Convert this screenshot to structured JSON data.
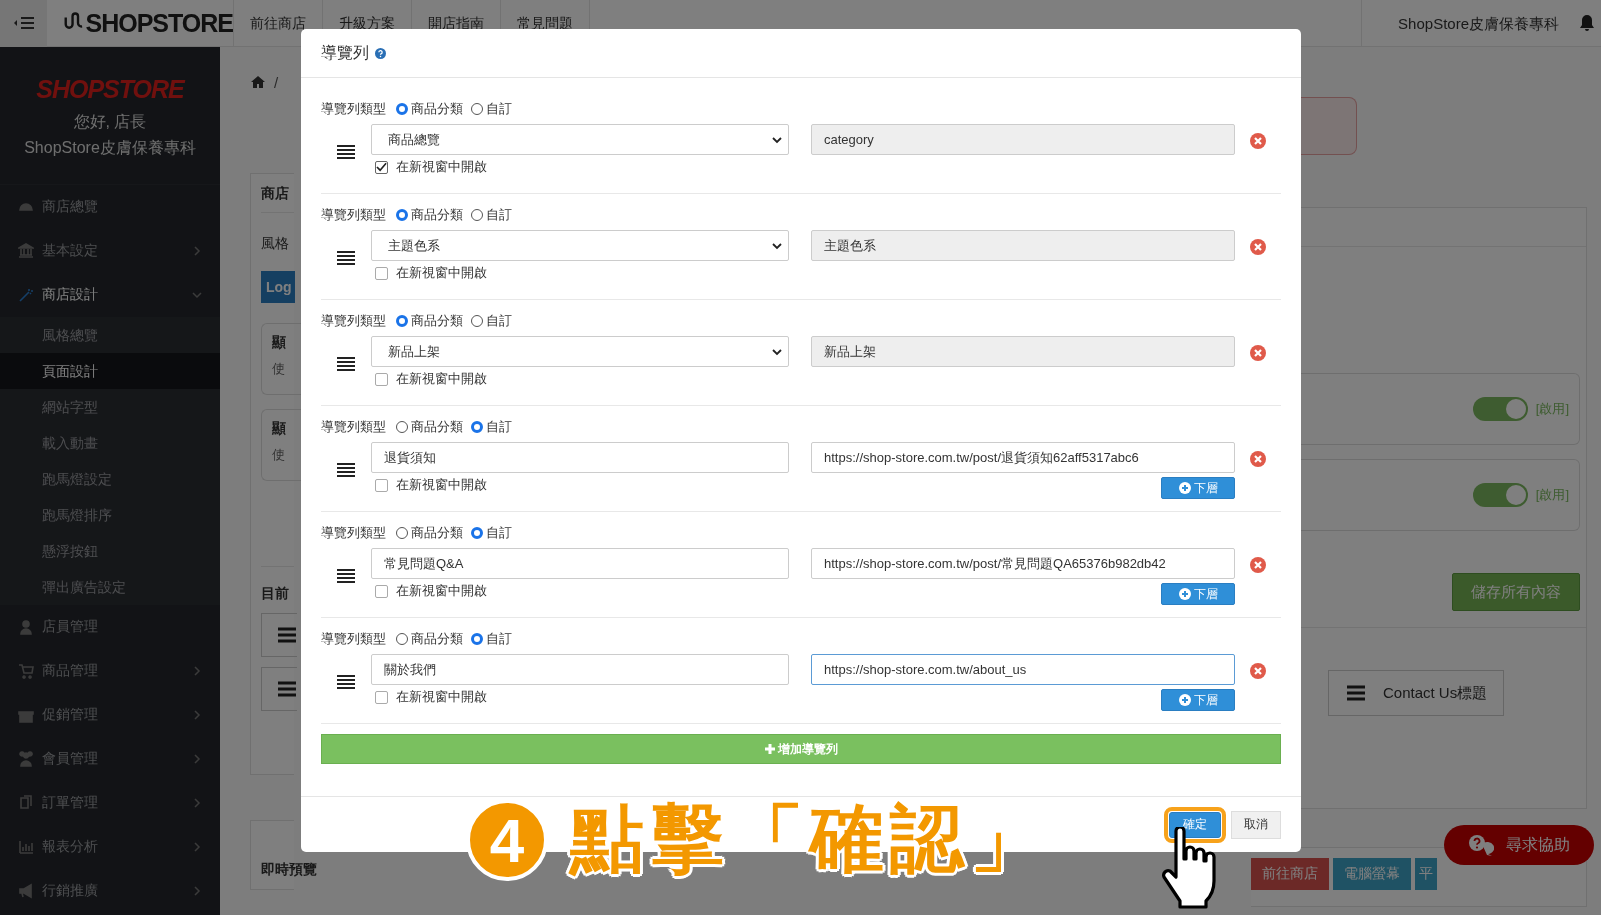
{
  "topbar": {
    "logo": "SHOPSTORE",
    "nav": [
      "前往商店",
      "升級方案",
      "開店指南",
      "常見問題"
    ],
    "store_name": "ShopStore皮膚保養專科"
  },
  "sidebar": {
    "logo": "SHOPSTORE",
    "greeting": "您好, 店長",
    "store_name": "ShopStore皮膚保養專科",
    "items": [
      {
        "label": "商店總覽",
        "selected": false
      },
      {
        "label": "基本設定",
        "selected": false,
        "expanded": false
      },
      {
        "label": "商店設計",
        "selected": true,
        "expanded": true,
        "children": [
          {
            "label": "風格總覽",
            "selected": false
          },
          {
            "label": "頁面設計",
            "selected": true
          },
          {
            "label": "網站字型",
            "selected": false
          },
          {
            "label": "載入動畫",
            "selected": false
          },
          {
            "label": "跑馬燈設定",
            "selected": false
          },
          {
            "label": "跑馬燈排序",
            "selected": false
          },
          {
            "label": "懸浮按鈕",
            "selected": false
          },
          {
            "label": "彈出廣告設定",
            "selected": false
          }
        ]
      },
      {
        "label": "店員管理",
        "selected": false
      },
      {
        "label": "商品管理",
        "selected": false,
        "expanded": false
      },
      {
        "label": "促銷管理",
        "selected": false,
        "expanded": false
      },
      {
        "label": "會員管理",
        "selected": false,
        "expanded": false
      },
      {
        "label": "訂單管理",
        "selected": false,
        "expanded": false
      },
      {
        "label": "報表分析",
        "selected": false,
        "expanded": false
      },
      {
        "label": "行銷推廣",
        "selected": false,
        "expanded": false
      }
    ]
  },
  "page_left": {
    "breadcrumb_separator": "/",
    "card_title": "商店",
    "style_label": "風格",
    "logo_button": "Log",
    "settings": [
      {
        "title": "顯",
        "desc": "使"
      },
      {
        "title": "顯",
        "desc": "使"
      }
    ],
    "current_label": "目前",
    "preview_title": "即時預覽"
  },
  "page_right": {
    "toggles": [
      {
        "on": true,
        "label": "[啟用]"
      },
      {
        "on": true,
        "label": "[啟用]"
      }
    ],
    "save_button": "儲存所有內容",
    "menu_item": "Contact Us標題",
    "preview_buttons": [
      "前往商店",
      "電腦螢幕",
      "平"
    ],
    "help_button": "尋求協助"
  },
  "modal": {
    "title": "導覽列",
    "rows": [
      {
        "kind": "category",
        "type_label": "導覽列類型",
        "options": [
          {
            "label": "商品分類",
            "selected": true
          },
          {
            "label": "自訂",
            "selected": false
          }
        ],
        "name": "商品總覽",
        "link": "category",
        "new_window_label": "在新視窗中開啟",
        "new_window": true,
        "focused": false
      },
      {
        "kind": "category",
        "type_label": "導覽列類型",
        "options": [
          {
            "label": "商品分類",
            "selected": true
          },
          {
            "label": "自訂",
            "selected": false
          }
        ],
        "name": "主題色系",
        "link": "主題色系",
        "new_window_label": "在新視窗中開啟",
        "new_window": false,
        "focused": false
      },
      {
        "kind": "category",
        "type_label": "導覽列類型",
        "options": [
          {
            "label": "商品分類",
            "selected": true
          },
          {
            "label": "自訂",
            "selected": false
          }
        ],
        "name": "新品上架",
        "link": "新品上架",
        "new_window_label": "在新視窗中開啟",
        "new_window": false,
        "focused": false
      },
      {
        "kind": "custom",
        "type_label": "導覽列類型",
        "options": [
          {
            "label": "商品分類",
            "selected": false
          },
          {
            "label": "自訂",
            "selected": true
          }
        ],
        "name": "退貨須知",
        "link": "https://shop-store.com.tw/post/退貨須知62aff5317abc6",
        "new_window_label": "在新視窗中開啟",
        "new_window": false,
        "focused": false,
        "sub_button": "下層"
      },
      {
        "kind": "custom",
        "type_label": "導覽列類型",
        "options": [
          {
            "label": "商品分類",
            "selected": false
          },
          {
            "label": "自訂",
            "selected": true
          }
        ],
        "name": "常見問題Q&A",
        "link": "https://shop-store.com.tw/post/常見問題QA65376b982db42",
        "new_window_label": "在新視窗中開啟",
        "new_window": false,
        "focused": false,
        "sub_button": "下層"
      },
      {
        "kind": "custom",
        "type_label": "導覽列類型",
        "options": [
          {
            "label": "商品分類",
            "selected": false
          },
          {
            "label": "自訂",
            "selected": true
          }
        ],
        "name": "關於我們",
        "link": "https://shop-store.com.tw/about_us",
        "new_window_label": "在新視窗中開啟",
        "new_window": false,
        "focused": true,
        "sub_button": "下層"
      }
    ],
    "add_button": "增加導覽列",
    "confirm_button": "確定",
    "confirm_highlighted": true,
    "cancel_button": "取消"
  },
  "annotation": {
    "step": "4",
    "text": "點擊「確認」"
  }
}
